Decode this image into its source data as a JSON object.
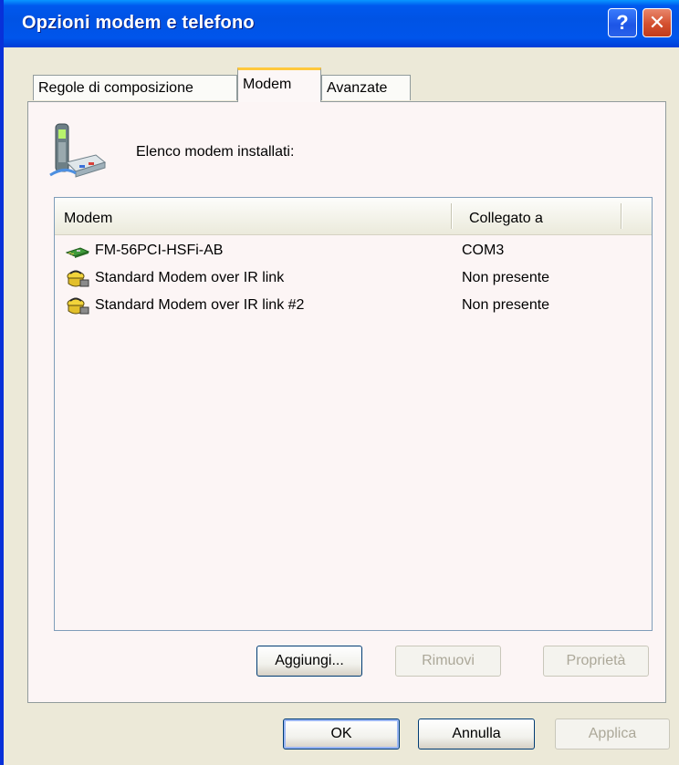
{
  "window": {
    "title": "Opzioni modem e telefono"
  },
  "titlebar": {
    "help_label": "?",
    "close_label": "✕"
  },
  "tabs": [
    {
      "label": "Regole di composizione"
    },
    {
      "label": "Modem"
    },
    {
      "label": "Avanzate"
    }
  ],
  "panel": {
    "installed_label": "Elenco modem installati:"
  },
  "list": {
    "columns": [
      "Modem",
      "Collegato a"
    ],
    "rows": [
      {
        "name": "FM-56PCI-HSFi-AB",
        "port": "COM3",
        "icon": "pci-modem-card-icon"
      },
      {
        "name": "Standard Modem over IR link",
        "port": "Non presente",
        "icon": "modem-phone-icon"
      },
      {
        "name": "Standard Modem over IR link #2",
        "port": "Non presente",
        "icon": "modem-phone-icon"
      }
    ]
  },
  "buttons": {
    "add": "Aggiungi...",
    "remove": "Rimuovi",
    "properties": "Proprietà",
    "ok": "OK",
    "cancel": "Annulla",
    "apply": "Applica"
  },
  "colors": {
    "titlebar_blue": "#0055eb",
    "selected_tab_accent": "#ffc83c",
    "close_button_red": "#d4502f"
  }
}
